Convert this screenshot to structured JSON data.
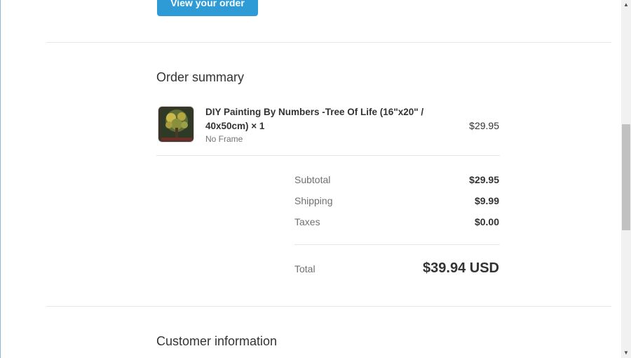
{
  "header": {
    "view_order_label": "View your order"
  },
  "order_summary": {
    "title": "Order summary",
    "item": {
      "name": "DIY Painting By Numbers -Tree Of Life (16\"x20\" / 40x50cm) × 1",
      "variant": "No Frame",
      "price": "$29.95",
      "thumbnail_icon": "tree-of-life-painting-thumbnail"
    },
    "subtotal": {
      "label": "Subtotal",
      "value": "$29.95"
    },
    "shipping": {
      "label": "Shipping",
      "value": "$9.99"
    },
    "taxes": {
      "label": "Taxes",
      "value": "$0.00"
    },
    "total": {
      "label": "Total",
      "value": "$39.94 USD"
    }
  },
  "customer_information": {
    "title": "Customer information"
  },
  "scrollbar": {
    "up_icon": "chevron-up-icon",
    "down_icon": "chevron-down-icon"
  },
  "colors": {
    "button": "#2e9bd6",
    "text": "#333333",
    "muted": "#707070",
    "divider": "#e6e6e6"
  }
}
